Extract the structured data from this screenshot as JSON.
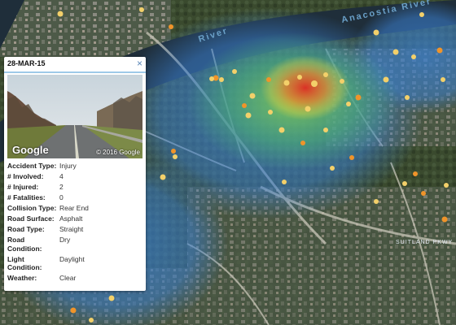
{
  "map": {
    "river_label_1": "Anacostia River",
    "river_label_2": "River",
    "road_label": "SUITLAND PKWY",
    "colors": {
      "water": "#1f2e3a",
      "heat_low": "#3a7fd0",
      "heat_mid": "#5ec26a",
      "heat_high": "#e03a2a",
      "marker_orange": "#f0942a",
      "marker_yellow": "#f3d06a"
    }
  },
  "popup": {
    "date": "28-MAR-15",
    "close_label": "×",
    "streetview": {
      "google_label": "Google",
      "copyright": "© 2016 Google"
    },
    "fields": [
      {
        "label": "Accident Type:",
        "value": "Injury"
      },
      {
        "label": "# Involved:",
        "value": "4"
      },
      {
        "label": "# Injured:",
        "value": "2"
      },
      {
        "label": "# Fatalities:",
        "value": "0"
      },
      {
        "label": "Collision Type:",
        "value": "Rear End"
      },
      {
        "label": "Road Surface:",
        "value": "Asphalt"
      },
      {
        "label": "Road Type:",
        "value": "Straight"
      },
      {
        "label": "Road Condition:",
        "value": "Dry"
      },
      {
        "label": "Light Condition:",
        "value": "Daylight"
      },
      {
        "label": "Weather:",
        "value": "Clear"
      }
    ]
  }
}
